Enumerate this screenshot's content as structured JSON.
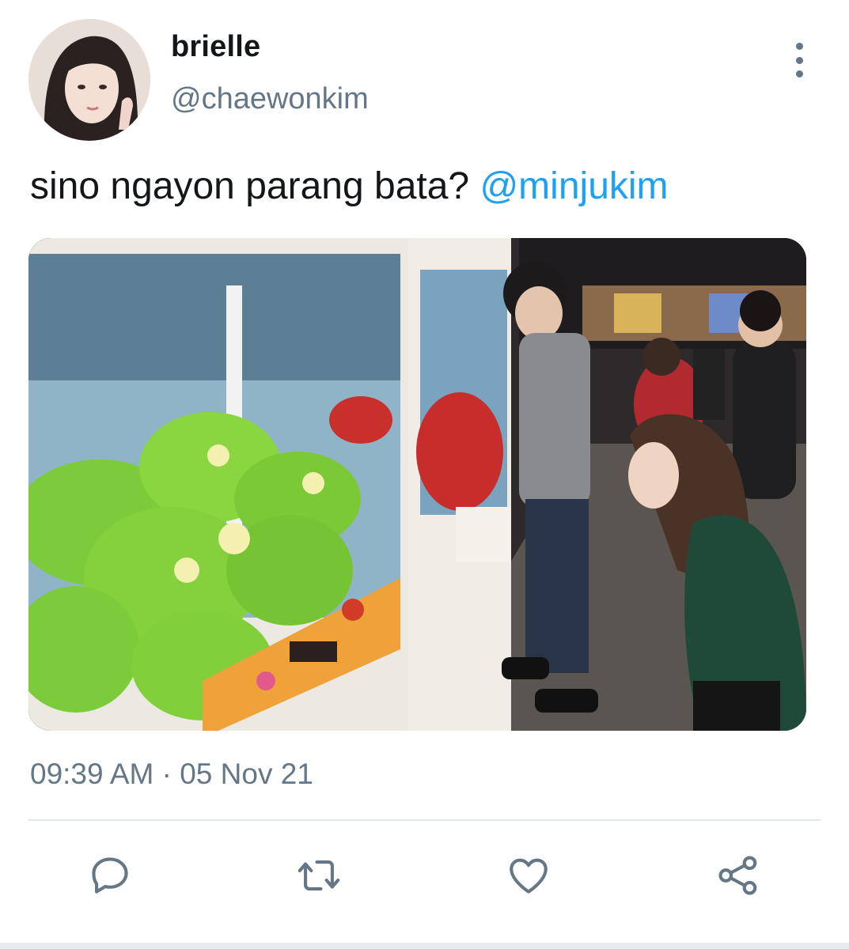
{
  "user": {
    "display_name": "brielle",
    "handle": "@chaewonkim",
    "avatar_icon": "profile-photo"
  },
  "tweet": {
    "text": "sino ngayon parang bata? ",
    "mention": "@minjukim",
    "timestamp": "09:39 AM · 05 Nov 21",
    "media_description_icon": "photo"
  },
  "actions": {
    "reply_icon": "reply-icon",
    "retweet_icon": "retweet-icon",
    "like_icon": "heart-icon",
    "share_icon": "share-icon",
    "more_icon": "more-vertical-icon"
  },
  "colors": {
    "text": "#14171a",
    "secondary": "#657786",
    "accent": "#1da1f2",
    "divider": "#e1e8ed"
  }
}
